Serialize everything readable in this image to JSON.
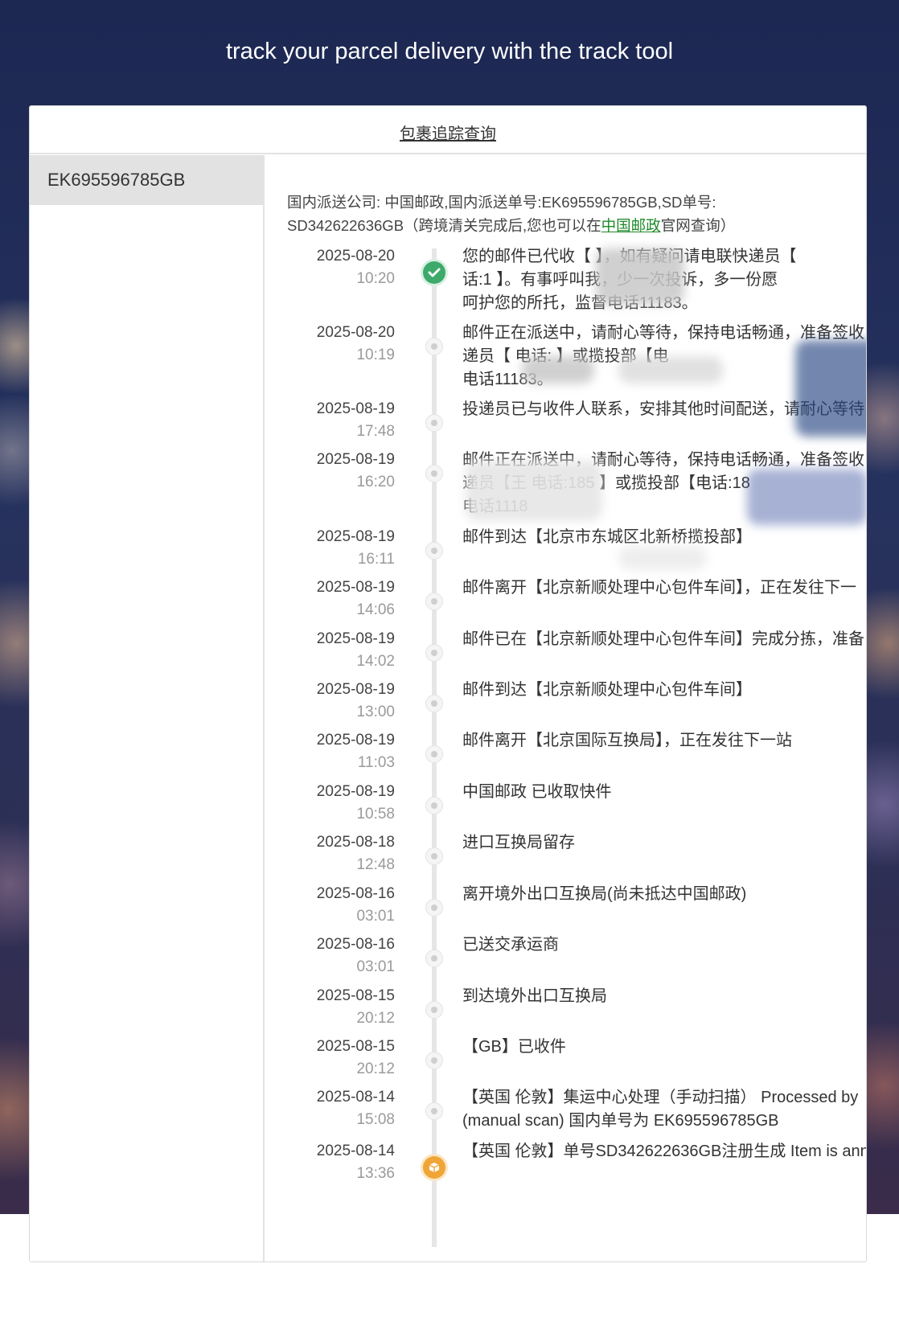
{
  "hero": {
    "tagline": "track your parcel delivery with the track tool"
  },
  "card": {
    "header_link": "包裹追踪查询"
  },
  "sidebar": {
    "items": [
      {
        "label": "EK695596785GB"
      }
    ]
  },
  "info": {
    "line1": "国内派送公司: 中国邮政,国内派送单号:EK695596785GB,SD单号:",
    "line2_pre": "SD342622636GB（跨境清关完成后,您也可以在",
    "line2_link": "中国邮政",
    "line2_post": "官网查询）"
  },
  "colors": {
    "background_top": "#1c2852",
    "delivered_green": "#3daa6b",
    "origin_orange": "#f0a537",
    "link_green": "#1e8a2a"
  },
  "events": [
    {
      "date": "2025-08-20",
      "time": "10:20",
      "status": "delivered",
      "lines": [
        "您的邮件已代收【                   】，如有疑问请电联快递员【",
        "话:1                    】。有事呼叫我，少一次投诉，多一份愿",
        "呵护您的所托，监督电话11183。"
      ]
    },
    {
      "date": "2025-08-20",
      "time": "10:19",
      "lines": [
        "邮件正在派送中，请耐心等待，保持电话畅通，准备签收",
        "递员【              电话:                    】或揽投部【电",
        "电话11183。"
      ]
    },
    {
      "date": "2025-08-19",
      "time": "17:48",
      "lines": [
        "投递员已与收件人联系，安排其他时间配送，请耐心等待"
      ]
    },
    {
      "date": "2025-08-19",
      "time": "16:20",
      "lines": [
        "邮件正在派送中，请耐心等待，保持电话畅通，准备签收",
        "递员【王          电话:185          】或揽投部【电话:18",
        "电话1118"
      ]
    },
    {
      "date": "2025-08-19",
      "time": "16:11",
      "lines": [
        "邮件到达【北京市东城区北新桥揽投部】"
      ]
    },
    {
      "date": "2025-08-19",
      "time": "14:06",
      "lines": [
        "邮件离开【北京新顺处理中心包件车间】，正在发往下一"
      ]
    },
    {
      "date": "2025-08-19",
      "time": "14:02",
      "lines": [
        "邮件已在【北京新顺处理中心包件车间】完成分拣，准备"
      ]
    },
    {
      "date": "2025-08-19",
      "time": "13:00",
      "lines": [
        "邮件到达【北京新顺处理中心包件车间】"
      ]
    },
    {
      "date": "2025-08-19",
      "time": "11:03",
      "lines": [
        "邮件离开【北京国际互换局】，正在发往下一站"
      ]
    },
    {
      "date": "2025-08-19",
      "time": "10:58",
      "lines": [
        "中国邮政 已收取快件"
      ]
    },
    {
      "date": "2025-08-18",
      "time": "12:48",
      "lines": [
        "进口互换局留存"
      ]
    },
    {
      "date": "2025-08-16",
      "time": "03:01",
      "lines": [
        "离开境外出口互换局(尚未抵达中国邮政)"
      ]
    },
    {
      "date": "2025-08-16",
      "time": "03:01",
      "lines": [
        "已送交承运商"
      ]
    },
    {
      "date": "2025-08-15",
      "time": "20:12",
      "lines": [
        "到达境外出口互换局"
      ]
    },
    {
      "date": "2025-08-15",
      "time": "20:12",
      "lines": [
        "【GB】已收件"
      ]
    },
    {
      "date": "2025-08-14",
      "time": "15:08",
      "lines": [
        "【英国 伦敦】集运中心处理（手动扫描） Processed by",
        "(manual scan) 国内单号为 EK695596785GB"
      ]
    },
    {
      "date": "2025-08-14",
      "time": "13:36",
      "status": "origin",
      "lines": [
        "【英国 伦敦】单号SD342622636GB注册生成 Item is ann"
      ]
    }
  ]
}
